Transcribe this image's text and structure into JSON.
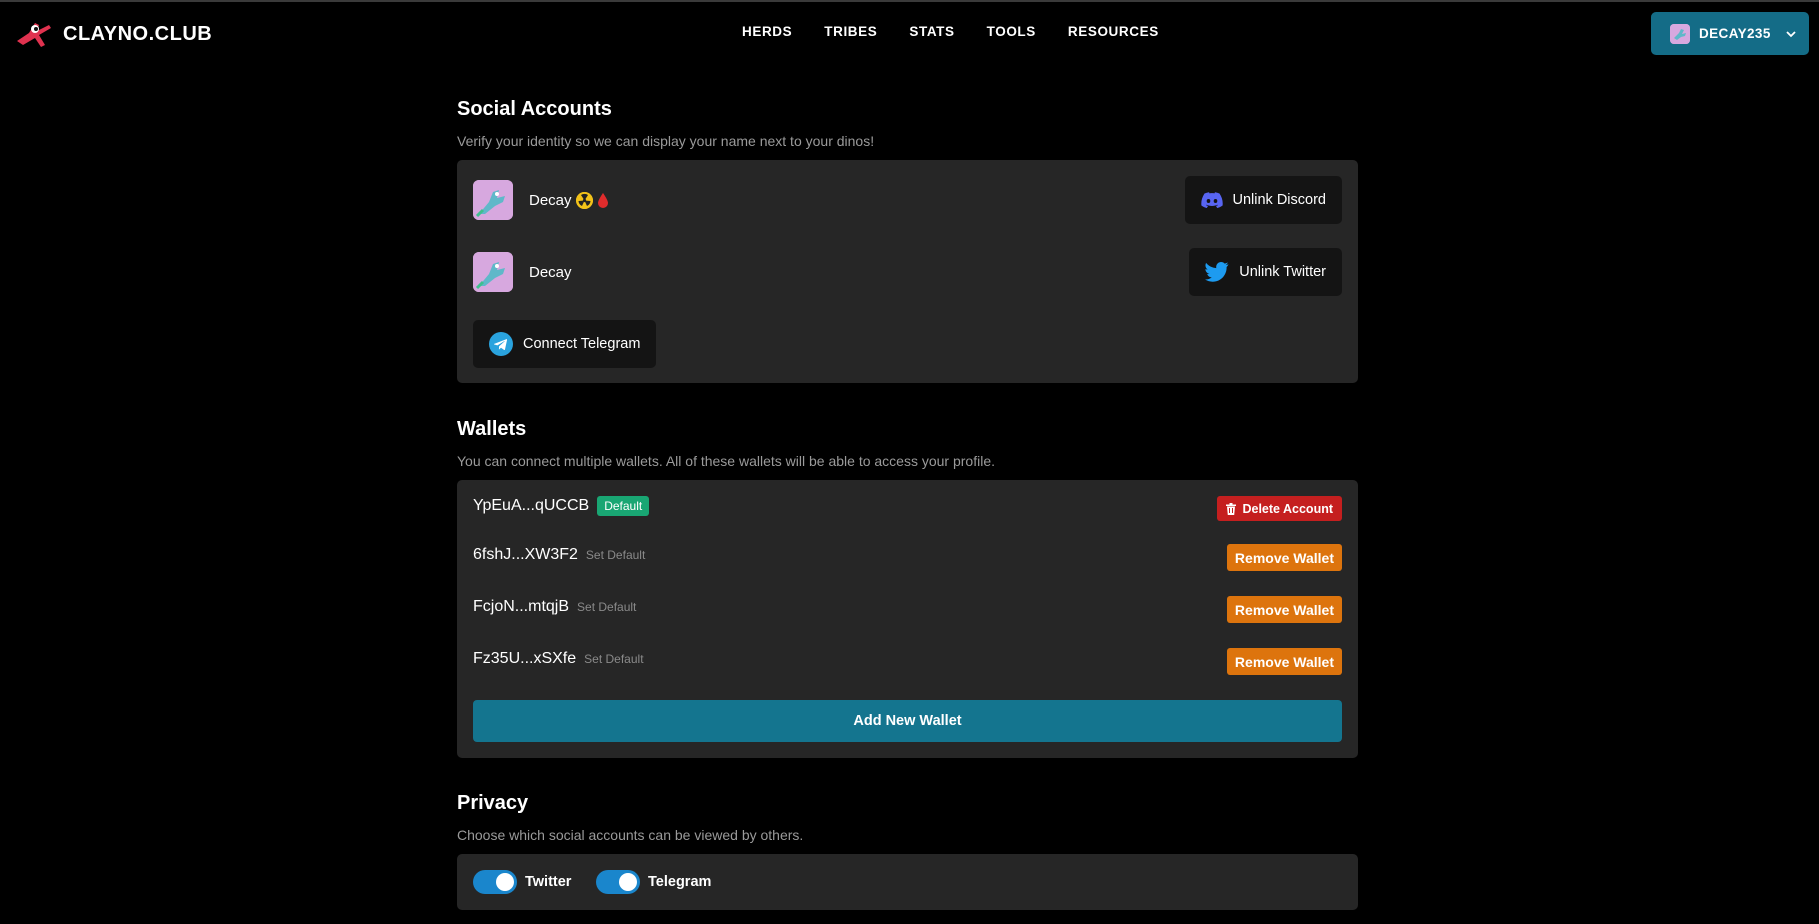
{
  "brand": {
    "name": "CLAYNO.CLUB"
  },
  "nav": {
    "links": [
      "HERDS",
      "TRIBES",
      "STATS",
      "TOOLS",
      "RESOURCES"
    ],
    "user": {
      "name": "DECAY235"
    }
  },
  "social": {
    "title": "Social Accounts",
    "description": "Verify your identity so we can display your name next to your dinos!",
    "discord": {
      "name": "Decay",
      "button": "Unlink Discord"
    },
    "twitter": {
      "name": "Decay",
      "button": "Unlink Twitter"
    },
    "telegram": {
      "button": "Connect Telegram"
    }
  },
  "wallets": {
    "title": "Wallets",
    "description": "You can connect multiple wallets. All of these wallets will be able to access your profile.",
    "items": [
      {
        "address": "YpEuA...qUCCB",
        "badge": "Default",
        "action": "Delete Account"
      },
      {
        "address": "6fshJ...XW3F2",
        "set_default": "Set Default",
        "action": "Remove Wallet"
      },
      {
        "address": "FcjoN...mtqjB",
        "set_default": "Set Default",
        "action": "Remove Wallet"
      },
      {
        "address": "Fz35U...xSXfe",
        "set_default": "Set Default",
        "action": "Remove Wallet"
      }
    ],
    "add_button": "Add New Wallet"
  },
  "privacy": {
    "title": "Privacy",
    "description": "Choose which social accounts can be viewed by others.",
    "toggles": [
      {
        "label": "Twitter",
        "on": true
      },
      {
        "label": "Telegram",
        "on": true
      }
    ]
  },
  "colors": {
    "accent": "#146c87",
    "default_badge": "#19a673",
    "delete": "#c51f1f",
    "remove": "#dd740d",
    "toggle_on": "#1a86cc"
  }
}
